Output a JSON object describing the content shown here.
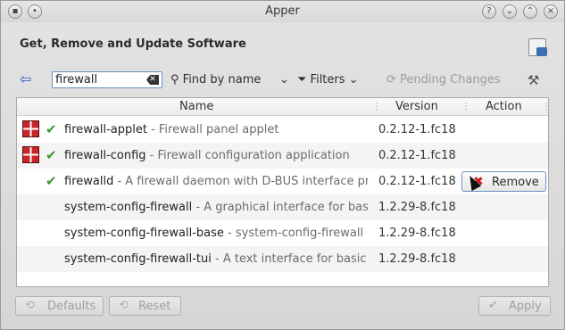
{
  "window": {
    "title": "Apper"
  },
  "header": {
    "title": "Get, Remove and Update Software"
  },
  "toolbar": {
    "search_value": "firewall",
    "find_label": "Find by name",
    "filters_label": "Filters",
    "pending_label": "Pending Changes"
  },
  "columns": {
    "name": "Name",
    "version": "Version",
    "action": "Action"
  },
  "packages": [
    {
      "name": "firewall-applet",
      "summary": " - Firewall panel applet",
      "version": "0.2.12-1.fc18"
    },
    {
      "name": "firewall-config",
      "summary": " - Firewall configuration application",
      "version": "0.2.12-1.fc18"
    },
    {
      "name": "firewalld",
      "summary": " - A firewall daemon with D-BUS interface pro",
      "version": "0.2.12-1.fc18"
    },
    {
      "name": "system-config-firewall",
      "summary": " - A graphical interface for basic",
      "version": "1.2.29-8.fc18"
    },
    {
      "name": "system-config-firewall-base",
      "summary": " - system-config-firewall ba",
      "version": "1.2.29-8.fc18"
    },
    {
      "name": "system-config-firewall-tui",
      "summary": " - A text interface for basic fi",
      "version": "1.2.29-8.fc18"
    }
  ],
  "row_action": {
    "remove_label": "Remove"
  },
  "footer": {
    "defaults_label": "Defaults",
    "reset_label": "Reset",
    "apply_label": "Apply"
  }
}
